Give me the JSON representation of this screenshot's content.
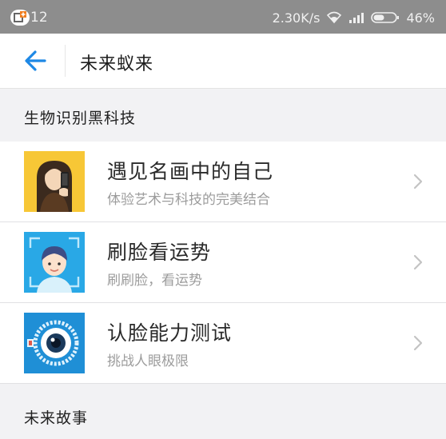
{
  "status_bar": {
    "time": "12",
    "net_speed": "2.30K/s",
    "battery": "46%",
    "icons": [
      "app-notification-icon",
      "wifi-icon",
      "signal-icon",
      "battery-icon"
    ]
  },
  "header": {
    "back_icon": "arrow-left-icon",
    "title": "未来蚁来",
    "accent": "#1e88e5"
  },
  "sections": [
    {
      "label": "生物识别黑科技"
    },
    {
      "label": "未来故事"
    }
  ],
  "items": [
    {
      "title": "遇见名画中的自己",
      "subtitle": "体验艺术与科技的完美结合",
      "icon": "mona-lisa-icon",
      "thumb_color": "#f7c736"
    },
    {
      "title": "刷脸看运势",
      "subtitle": "刷刷脸，看运势",
      "icon": "face-scan-icon",
      "thumb_color": "#29a8e6"
    },
    {
      "title": "认脸能力测试",
      "subtitle": "挑战人眼极限",
      "icon": "eye-scan-icon",
      "thumb_color": "#1f8fd6"
    }
  ]
}
